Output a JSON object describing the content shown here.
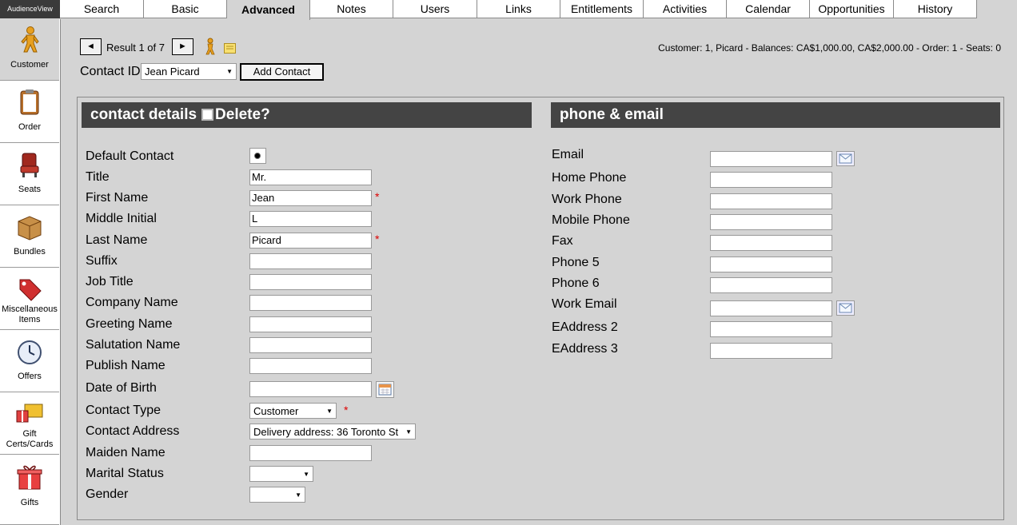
{
  "app": {
    "logo": "AudienceView"
  },
  "tabs": [
    {
      "label": "Search"
    },
    {
      "label": "Basic"
    },
    {
      "label": "Advanced"
    },
    {
      "label": "Notes"
    },
    {
      "label": "Users"
    },
    {
      "label": "Links"
    },
    {
      "label": "Entitlements"
    },
    {
      "label": "Activities"
    },
    {
      "label": "Calendar"
    },
    {
      "label": "Opportunities"
    },
    {
      "label": "History"
    }
  ],
  "active_tab": "Advanced",
  "sidebar": {
    "items": [
      {
        "label": "Customer",
        "icon": "customer-icon"
      },
      {
        "label": "Order",
        "icon": "clipboard-icon"
      },
      {
        "label": "Seats",
        "icon": "seat-icon"
      },
      {
        "label": "Bundles",
        "icon": "box-icon"
      },
      {
        "label": "Miscellaneous Items",
        "icon": "price-tag-icon"
      },
      {
        "label": "Offers",
        "icon": "clock-icon"
      },
      {
        "label": "Gift Certs/Cards",
        "icon": "gift-card-icon"
      },
      {
        "label": "Gifts",
        "icon": "gift-icon"
      }
    ]
  },
  "result_bar": {
    "prev": "◄",
    "next": "►",
    "result_text": "Result 1 of 7",
    "customer_summary": "Customer: 1, Picard - Balances: CA$1,000.00, CA$2,000.00 - Order: 1 - Seats: 0"
  },
  "contact_id": {
    "label": "Contact ID",
    "value": "Jean Picard",
    "add_button": "Add Contact"
  },
  "contact_details": {
    "title": "contact details",
    "delete_label": "Delete?",
    "fields": {
      "default_contact": {
        "label": "Default Contact"
      },
      "title": {
        "label": "Title",
        "value": "Mr."
      },
      "first_name": {
        "label": "First Name",
        "value": "Jean",
        "required": "*"
      },
      "middle_initial": {
        "label": "Middle Initial",
        "value": "L"
      },
      "last_name": {
        "label": "Last Name",
        "value": "Picard",
        "required": "*"
      },
      "suffix": {
        "label": "Suffix",
        "value": ""
      },
      "job_title": {
        "label": "Job Title",
        "value": ""
      },
      "company_name": {
        "label": "Company Name",
        "value": ""
      },
      "greeting_name": {
        "label": "Greeting Name",
        "value": ""
      },
      "salutation_name": {
        "label": "Salutation Name",
        "value": ""
      },
      "publish_name": {
        "label": "Publish Name",
        "value": ""
      },
      "date_of_birth": {
        "label": "Date of Birth",
        "value": ""
      },
      "contact_type": {
        "label": "Contact Type",
        "value": "Customer",
        "required": "*"
      },
      "contact_address": {
        "label": "Contact Address",
        "value": "Delivery address: 36 Toronto St"
      },
      "maiden_name": {
        "label": "Maiden Name",
        "value": ""
      },
      "marital_status": {
        "label": "Marital Status",
        "value": ""
      },
      "gender": {
        "label": "Gender",
        "value": ""
      }
    }
  },
  "phone_email": {
    "title": "phone & email",
    "fields": {
      "email": {
        "label": "Email",
        "value": ""
      },
      "home_phone": {
        "label": "Home Phone",
        "value": ""
      },
      "work_phone": {
        "label": "Work Phone",
        "value": ""
      },
      "mobile_phone": {
        "label": "Mobile Phone",
        "value": ""
      },
      "fax": {
        "label": "Fax",
        "value": ""
      },
      "phone5": {
        "label": "Phone 5",
        "value": ""
      },
      "phone6": {
        "label": "Phone 6",
        "value": ""
      },
      "work_email": {
        "label": "Work Email",
        "value": ""
      },
      "eaddress2": {
        "label": "EAddress 2",
        "value": ""
      },
      "eaddress3": {
        "label": "EAddress 3",
        "value": ""
      }
    }
  },
  "colors": {
    "background": "#d4d4d4",
    "section_header": "#444444",
    "required": "#dd0000"
  }
}
